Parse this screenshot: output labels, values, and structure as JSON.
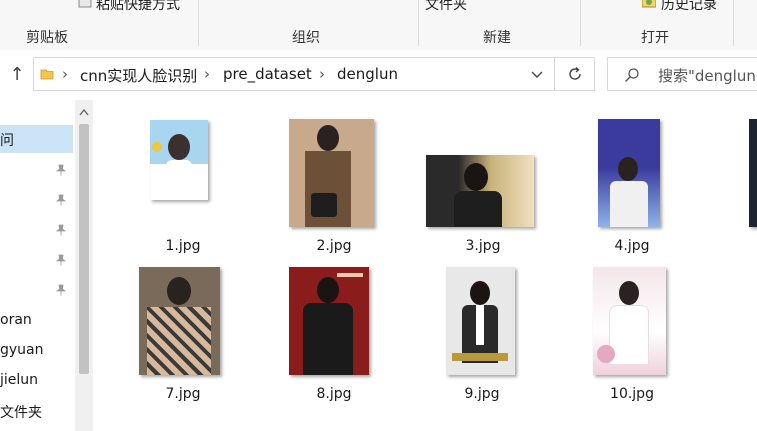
{
  "ribbon": {
    "clipboard_group": "剪贴板",
    "organize_group": "组织",
    "new_group": "新建",
    "open_group": "打开",
    "partial_paste_shortcut": "粘贴快捷方式",
    "partial_folder": "文件夹",
    "history": "历史记录"
  },
  "address": {
    "crumbs": [
      "cnn实现人脸识别",
      "pre_dataset",
      "denglun"
    ]
  },
  "search": {
    "placeholder": "搜索\"denglun"
  },
  "nav": {
    "items": [
      "问",
      "oran",
      "gyuan",
      "jielun",
      "文件夹"
    ]
  },
  "files": [
    {
      "name": "1.jpg",
      "palette": [
        "#a8d5ef",
        "#ffffff",
        "#f4c542"
      ]
    },
    {
      "name": "2.jpg",
      "palette": [
        "#c8a98c",
        "#6d5038",
        "#1e1e1e"
      ]
    },
    {
      "name": "3.jpg",
      "palette": [
        "#c9b27a",
        "#2a2a2a",
        "#f0e0c0"
      ]
    },
    {
      "name": "4.jpg",
      "palette": [
        "#3b3b9e",
        "#8fb3e8",
        "#f0f0f0"
      ]
    },
    {
      "name": "7.jpg",
      "palette": [
        "#7a6a5a",
        "#d8b89a",
        "#3a3a3a"
      ]
    },
    {
      "name": "8.jpg",
      "palette": [
        "#8a1c1c",
        "#1a1a1a",
        "#e8c8b0"
      ]
    },
    {
      "name": "9.jpg",
      "palette": [
        "#e8e8e8",
        "#2a2a2a",
        "#b89a3a"
      ]
    },
    {
      "name": "10.jpg",
      "palette": [
        "#f4e6ea",
        "#ffffff",
        "#e6a8c0"
      ]
    }
  ]
}
